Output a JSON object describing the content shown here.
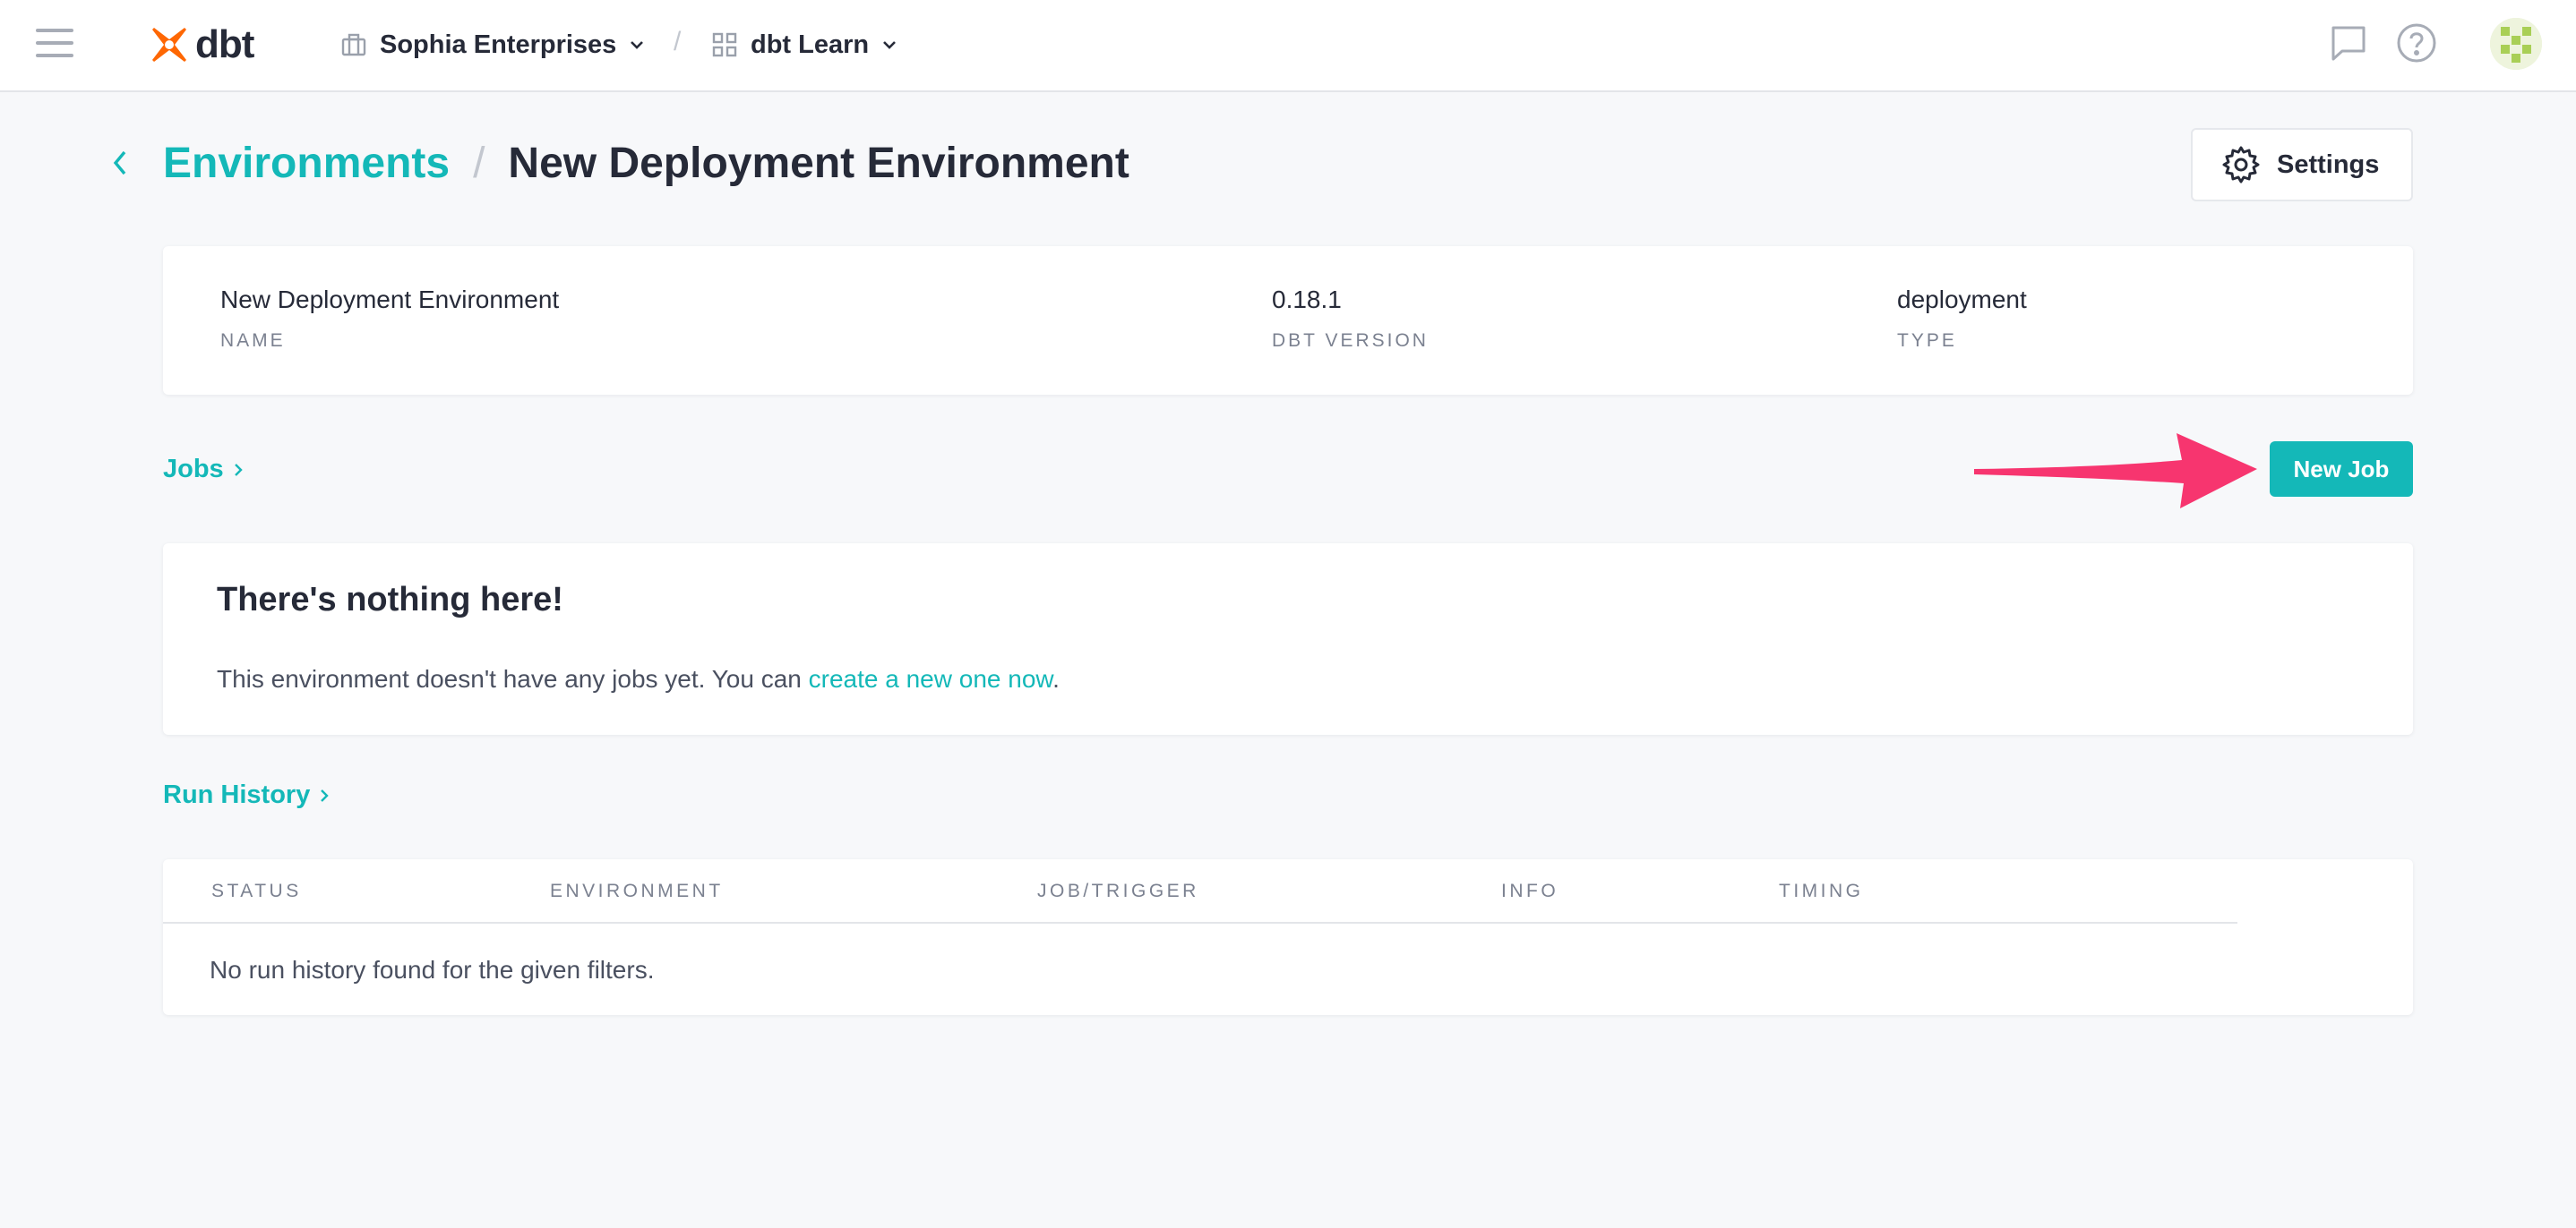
{
  "topbar": {
    "brand": "dbt",
    "account": "Sophia Enterprises",
    "separator": "/",
    "project": "dbt Learn"
  },
  "header": {
    "parent_link": "Environments",
    "separator": "/",
    "current": "New Deployment Environment",
    "settings_label": "Settings"
  },
  "environment": {
    "name_value": "New Deployment Environment",
    "name_label": "NAME",
    "version_value": "0.18.1",
    "version_label": "DBT VERSION",
    "type_value": "deployment",
    "type_label": "TYPE"
  },
  "jobs": {
    "link": "Jobs",
    "new_job_label": "New Job",
    "empty_title": "There's nothing here!",
    "empty_text_prefix": "This environment doesn't have any jobs yet. You can ",
    "empty_text_link": "create a new one now",
    "empty_text_suffix": "."
  },
  "run_history": {
    "link": "Run History",
    "columns": [
      "STATUS",
      "ENVIRONMENT",
      "JOB/TRIGGER",
      "INFO",
      "TIMING"
    ],
    "empty_message": "No run history found for the given filters."
  },
  "colors": {
    "accent": "#14b8b8",
    "arrow": "#f7356f",
    "brand_logo": "#fe6703"
  },
  "icons": [
    "hamburger-icon",
    "dbt-logo-icon",
    "building-icon",
    "grid-icon",
    "chevron-down-icon",
    "chat-icon",
    "help-icon",
    "chevron-left-icon",
    "gear-icon",
    "chevron-right-icon",
    "arrow-annotation"
  ]
}
